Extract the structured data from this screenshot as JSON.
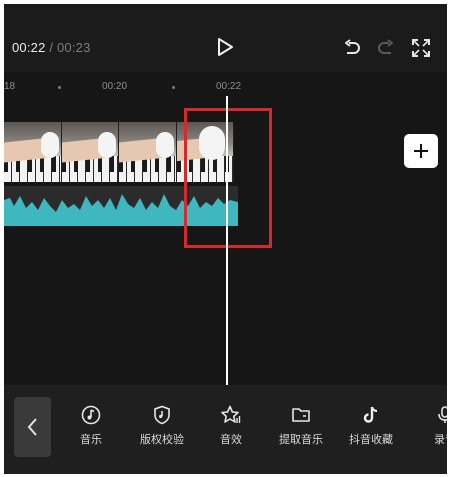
{
  "header": {
    "current_time": "00:22",
    "separator": "/",
    "total_duration": "00:23"
  },
  "ruler": {
    "labels": [
      "18",
      "00:20",
      "00:22"
    ]
  },
  "toolbar": {
    "items": [
      {
        "label": "音乐",
        "icon": "music-note-icon"
      },
      {
        "label": "版权校验",
        "icon": "copyright-shield-icon"
      },
      {
        "label": "音效",
        "icon": "sound-effect-icon"
      },
      {
        "label": "提取音乐",
        "icon": "folder-icon"
      },
      {
        "label": "抖音收藏",
        "icon": "douyin-icon"
      },
      {
        "label": "录音",
        "icon": "microphone-icon"
      }
    ]
  },
  "colors": {
    "background": "#161616",
    "highlight_box": "#d42a2f",
    "waveform": "#3fb7bf",
    "playhead": "#ffffff"
  }
}
